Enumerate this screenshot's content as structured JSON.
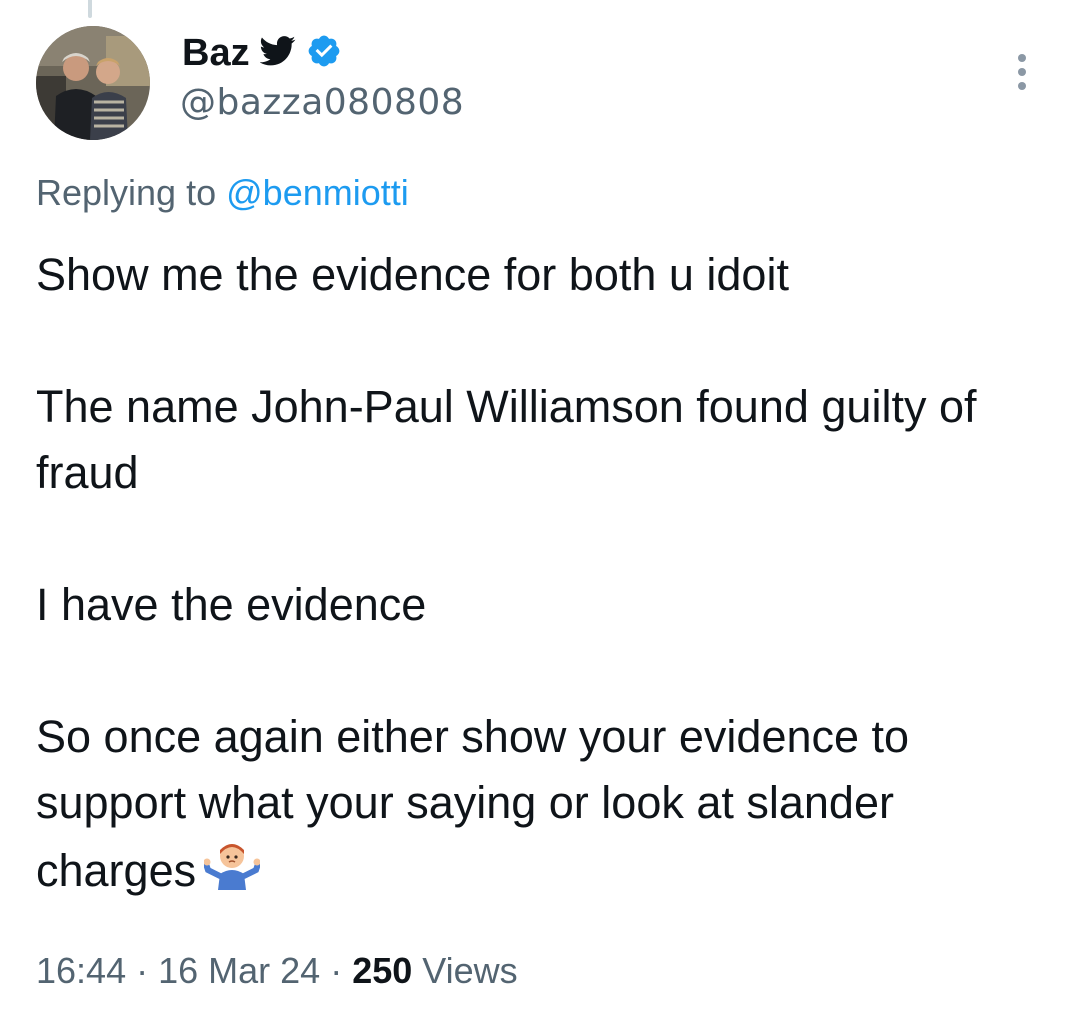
{
  "author": {
    "display_name": "Baz",
    "handle": "@bazza080808",
    "badges": [
      "twitter-bird-icon",
      "verified-badge-icon"
    ],
    "avatar_icon": "profile-photo-two-men"
  },
  "reply": {
    "prefix": "Replying to",
    "mention": "@benmiotti"
  },
  "tweet": {
    "paragraphs": [
      "Show me the evidence for both u idoit",
      "The name John-Paul Williamson found guilty of fraud",
      "I have the evidence",
      "So once again either show your evidence to support what your saying or look at slander charges"
    ],
    "trailing_emoji": "person-shrugging-emoji"
  },
  "meta": {
    "time": "16:44",
    "date": "16 Mar 24",
    "separator": "·",
    "views_count": "250",
    "views_label": "Views"
  },
  "colors": {
    "text_primary": "#0f1419",
    "text_secondary": "#536471",
    "accent": "#1d9bf0",
    "verified": "#1d9bf0"
  },
  "menu": {
    "icon": "more-options-vertical-icon"
  }
}
